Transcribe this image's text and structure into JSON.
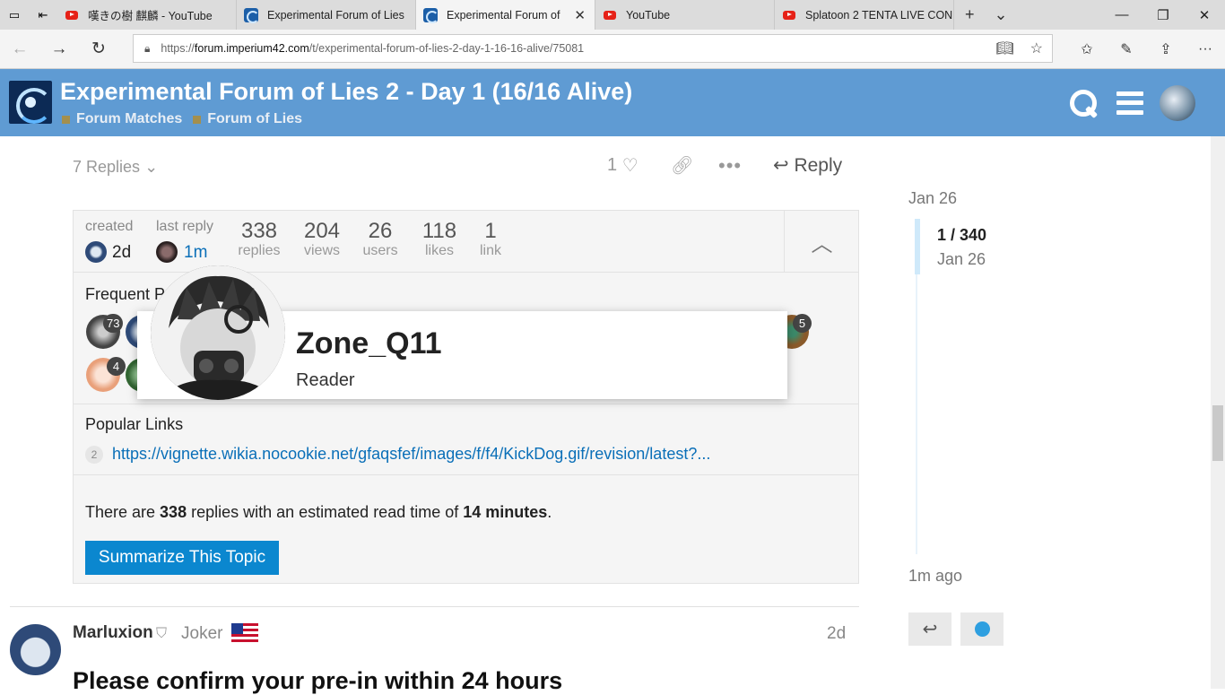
{
  "browser": {
    "tabs": [
      {
        "title": "嘆きの樹 麒麟 - YouTube",
        "favicon": "youtube-icon"
      },
      {
        "title": "Experimental Forum of Lies",
        "favicon": "imperium-icon"
      },
      {
        "title": "Experimental Forum of",
        "favicon": "imperium-icon",
        "active": true
      },
      {
        "title": "YouTube",
        "favicon": "youtube-icon"
      },
      {
        "title": "Splatoon 2 TENTA LIVE CON",
        "favicon": "youtube-icon"
      }
    ],
    "url_prefix": "https://",
    "url_domain": "forum.imperium42.com",
    "url_path": "/t/experimental-forum-of-lies-2-day-1-16-16-alive/75081"
  },
  "header": {
    "title": "Experimental Forum of Lies 2 - Day 1 (16/16 Alive)",
    "categories": [
      "Forum Matches",
      "Forum of Lies"
    ],
    "category_color": "#a38f4e",
    "bg_color": "#5f9bd3"
  },
  "controls": {
    "replies_toggle": "7 Replies",
    "like_count": "1",
    "reply_label": "Reply"
  },
  "topic_map": {
    "created_label": "created",
    "created_value": "2d",
    "last_reply_label": "last reply",
    "last_reply_value": "1m",
    "stats": [
      {
        "number": "338",
        "label": "replies"
      },
      {
        "number": "204",
        "label": "views"
      },
      {
        "number": "26",
        "label": "users"
      },
      {
        "number": "118",
        "label": "likes"
      },
      {
        "number": "1",
        "label": "link"
      }
    ],
    "frequent_posters_title": "Frequent Posters",
    "poster_counts": [
      "73",
      "4",
      "5"
    ],
    "popular_links_title": "Popular Links",
    "link_clicks": "2",
    "link_url": "https://vignette.wikia.nocookie.net/gfaqsfef/images/f/f4/KickDog.gif/revision/latest?...",
    "summary_pre": "There are ",
    "summary_replies": "338",
    "summary_mid": " replies with an estimated read time of ",
    "summary_time": "14 minutes",
    "summary_post": ".",
    "summarize_button": "Summarize This Topic"
  },
  "user_card": {
    "username": "Zone_Q11",
    "title": "Reader"
  },
  "post": {
    "username": "Marluxion",
    "user_title": "Joker",
    "date": "2d",
    "heading": "Please confirm your pre-in within 24 hours"
  },
  "timeline": {
    "start_date": "Jan 26",
    "position": "1 / 340",
    "position_date": "Jan 26",
    "end_label": "1m ago"
  }
}
